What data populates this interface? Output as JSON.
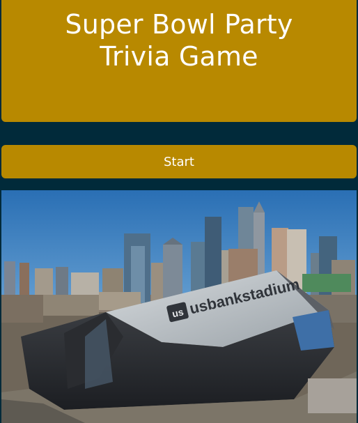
{
  "theme": {
    "gold": "#b88900",
    "background": "#012a3a",
    "text": "#ffffff"
  },
  "header": {
    "title": "Super Bowl Party Trivia Game"
  },
  "actions": {
    "start_label": "Start"
  },
  "photo": {
    "stadium_sign": "usbankstadium"
  }
}
